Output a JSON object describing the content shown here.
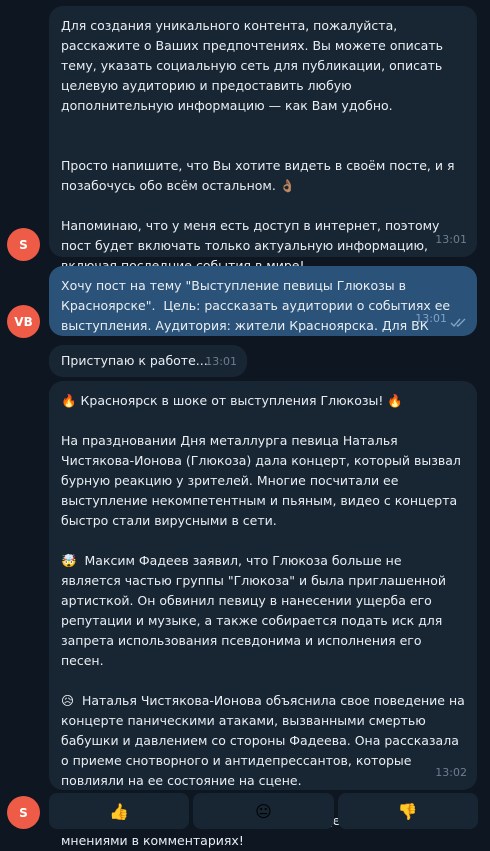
{
  "messages": [
    {
      "text": "Для создания уникального контента, пожалуйста, расскажите о Ваших предпочтениях. Вы можете описать тему, указать социальную сеть для публикации, описать целевую аудиторию и предоставить любую дополнительную информацию — как Вам удобно.\n\n\nПросто напишите, что Вы хотите видеть в своём посте, и я позабочусь обо всём остальном. 👌🏽\n\nНапоминаю, что у меня есть доступ в интернет, поэтому пост будет включать только актуальную информацию, включая последние события в мире!",
      "time": "13:01"
    },
    {
      "text": "Хочу пост на тему \"Выступление певицы Глюкозы в Красноярске\".  Цель: рассказать аудитории о событиях ее выступления. Аудитория: жители Красноярска. Для ВК",
      "time": "13:01"
    },
    {
      "text": "Приступаю к работе...",
      "time": "13:01"
    },
    {
      "text": "🔥 Красноярск в шоке от выступления Глюкозы! 🔥\n\nНа праздновании Дня металлурга певица Наталья Чистякова-Ионова (Глюкоза) дала концерт, который вызвал бурную реакцию у зрителей. Многие посчитали ее выступление некомпетентным и пьяным, видео с концерта быстро стали вирусными в сети.\n\n🤯  Максим Фадеев заявил, что Глюкоза больше не является частью группы \"Глюкоза\" и была приглашенной артисткой. Он обвинил певицу в нанесении ущерба его репутации и музыке, а также собирается подать иск для запрета использования псевдонима и исполнения его песен.\n\n😥  Наталья Чистякова-Ионова объяснила свое поведение на концерте паническими атаками, вызванными смертью бабушки и давлением со стороны Фадеева. Она рассказала о приеме снотворного и антидепрессантов, которые повлияли на ее состояние на сцене.\n\n🤔  Что вы думаете об этой ситуации?  Делитесь своими мнениями в комментариях!",
      "time": "13:02"
    }
  ],
  "avatars": {
    "bot": "S",
    "user": "VB"
  },
  "reactions": [
    "👍",
    "😐",
    "👎"
  ],
  "colors": {
    "background": "#0e1621",
    "incoming_bubble": "#182533",
    "outgoing_bubble": "#2b5278",
    "avatar": "#ee5b47"
  }
}
